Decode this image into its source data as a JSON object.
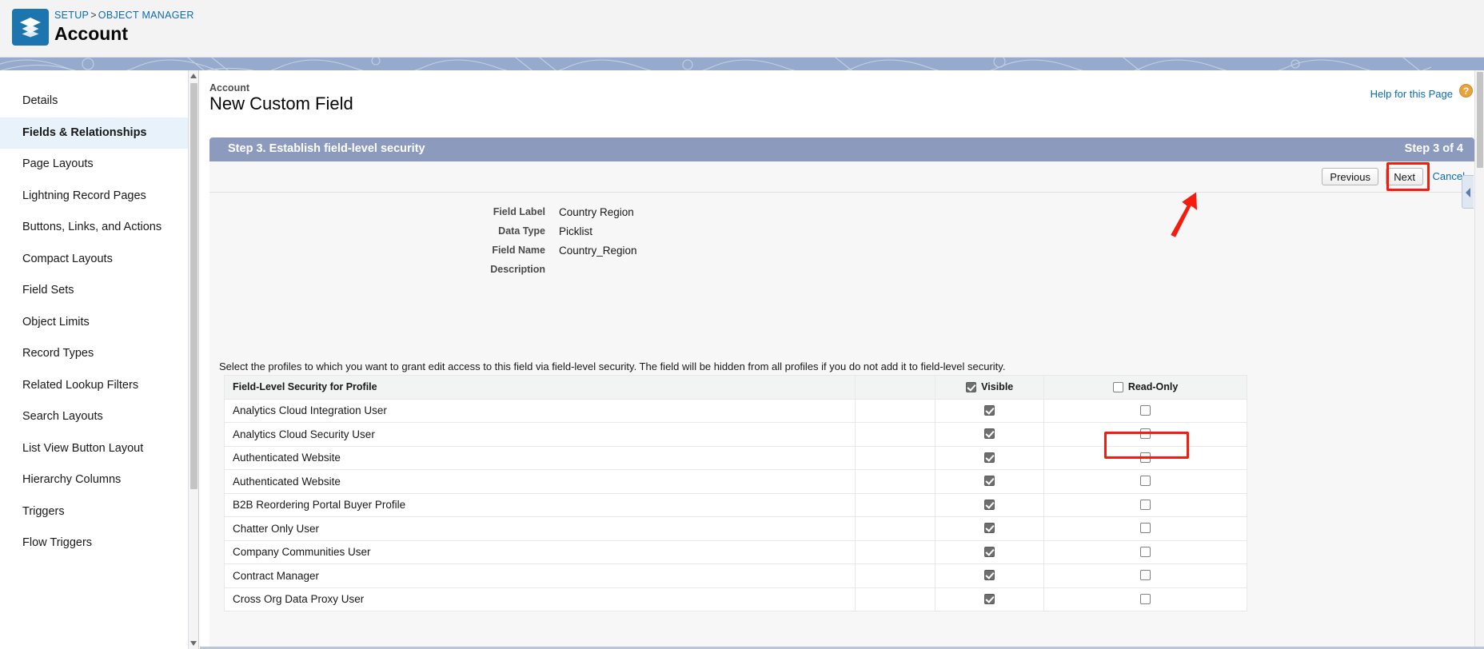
{
  "header": {
    "breadcrumb": {
      "setup": "SETUP",
      "separator": ">",
      "object_manager": "OBJECT MANAGER"
    },
    "title": "Account",
    "icon": "layers-icon",
    "icon_color": "#1c75ae"
  },
  "sidebar": {
    "items": [
      {
        "label": "Details",
        "active": false
      },
      {
        "label": "Fields & Relationships",
        "active": true
      },
      {
        "label": "Page Layouts",
        "active": false
      },
      {
        "label": "Lightning Record Pages",
        "active": false
      },
      {
        "label": "Buttons, Links, and Actions",
        "active": false
      },
      {
        "label": "Compact Layouts",
        "active": false
      },
      {
        "label": "Field Sets",
        "active": false
      },
      {
        "label": "Object Limits",
        "active": false
      },
      {
        "label": "Record Types",
        "active": false
      },
      {
        "label": "Related Lookup Filters",
        "active": false
      },
      {
        "label": "Search Layouts",
        "active": false
      },
      {
        "label": "List View Button Layout",
        "active": false
      },
      {
        "label": "Hierarchy Columns",
        "active": false
      },
      {
        "label": "Triggers",
        "active": false
      },
      {
        "label": "Flow Triggers",
        "active": false
      }
    ]
  },
  "main": {
    "eyebrow": "Account",
    "title": "New Custom Field",
    "help_link": "Help for this Page",
    "help_icon_glyph": "?",
    "step_bar": {
      "title": "Step 3. Establish field-level security",
      "counter": "Step 3 of 4",
      "color": "#8c9bbd"
    },
    "buttons": {
      "previous": "Previous",
      "next": "Next",
      "cancel": "Cancel"
    },
    "annotations": {
      "highlight_color": "#f41c0e",
      "next_button_highlighted": true,
      "visible_header_highlighted": true,
      "arrow_points_to": "Next"
    },
    "details": [
      {
        "label": "Field Label",
        "value": "Country Region"
      },
      {
        "label": "Data Type",
        "value": "Picklist"
      },
      {
        "label": "Field Name",
        "value": "Country_Region"
      },
      {
        "label": "Description",
        "value": ""
      }
    ],
    "instructions": "Select the profiles to which you want to grant edit access to this field via field-level security. The field will be hidden from all profiles if you do not add it to field-level security.",
    "table": {
      "headers": {
        "profile": "Field-Level Security for Profile",
        "visible": "Visible",
        "read_only": "Read-Only"
      },
      "header_checkboxes": {
        "visible": true,
        "read_only": false
      },
      "rows": [
        {
          "profile": "Analytics Cloud Integration User",
          "visible": true,
          "read_only": false
        },
        {
          "profile": "Analytics Cloud Security User",
          "visible": true,
          "read_only": false
        },
        {
          "profile": "Authenticated Website",
          "visible": true,
          "read_only": false
        },
        {
          "profile": "Authenticated Website",
          "visible": true,
          "read_only": false
        },
        {
          "profile": "B2B Reordering Portal Buyer Profile",
          "visible": true,
          "read_only": false
        },
        {
          "profile": "Chatter Only User",
          "visible": true,
          "read_only": false
        },
        {
          "profile": "Company Communities User",
          "visible": true,
          "read_only": false
        },
        {
          "profile": "Contract Manager",
          "visible": true,
          "read_only": false
        },
        {
          "profile": "Cross Org Data Proxy User",
          "visible": true,
          "read_only": false
        }
      ]
    }
  }
}
